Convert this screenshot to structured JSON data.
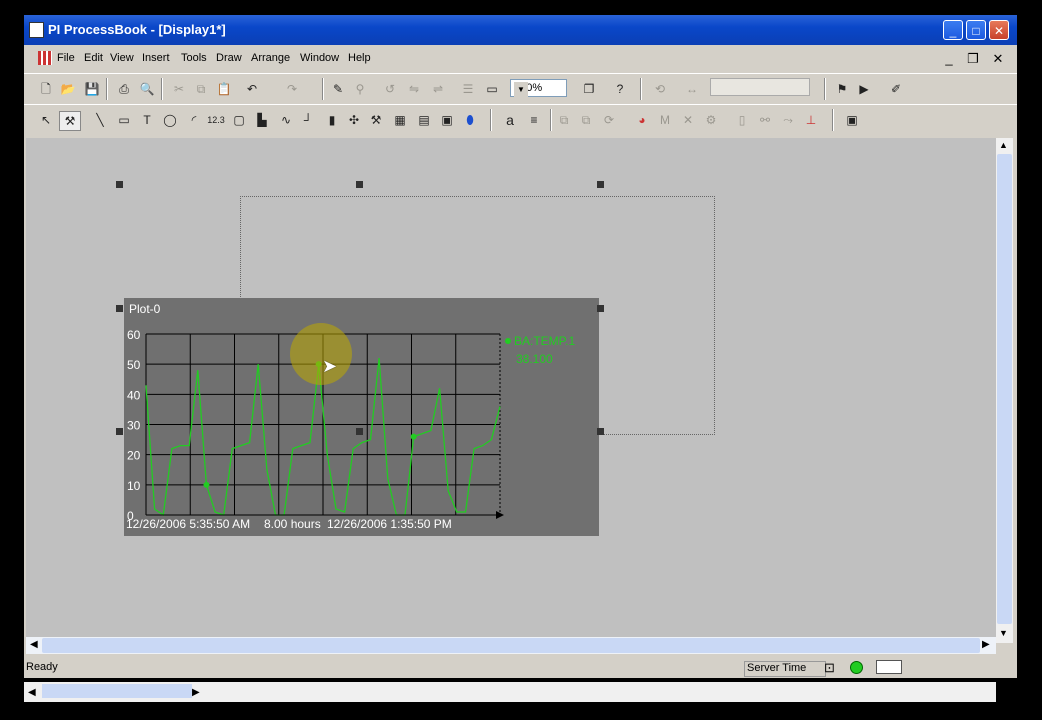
{
  "window": {
    "title": "PI ProcessBook - [Display1*]"
  },
  "menu": [
    "File",
    "Edit",
    "View",
    "Insert",
    "Tools",
    "Draw",
    "Arrange",
    "Window",
    "Help"
  ],
  "toolbar": {
    "zoom": "100%"
  },
  "plot": {
    "title": "Plot-0",
    "tag_name": "BA:TEMP.1",
    "tag_value": "38.100",
    "start_time": "12/26/2006 5:35:50 AM",
    "duration": "8.00 hours",
    "end_time": "12/26/2006 1:35:50 PM",
    "trace_color": "#22cc22"
  },
  "chart_data": {
    "type": "line",
    "series": [
      {
        "name": "BA:TEMP.1",
        "values": [
          43,
          2,
          0,
          22,
          23,
          23,
          48,
          10,
          1,
          0,
          22,
          23,
          24,
          50,
          15,
          0,
          0,
          22,
          23,
          24,
          50,
          20,
          2,
          1,
          22,
          24,
          25,
          52,
          12,
          0,
          0,
          26,
          27,
          28,
          42,
          8,
          1,
          1,
          22,
          23,
          25,
          36
        ]
      }
    ],
    "ylim": [
      0,
      60
    ],
    "yticks": [
      0,
      10,
      20,
      30,
      40,
      50,
      60
    ]
  },
  "status": {
    "left": "Ready",
    "server_time": "Server Time"
  },
  "colors": {
    "titlebar": "#0a47c9",
    "plot_bg": "#707070",
    "canvas": "#c0c0c0"
  }
}
